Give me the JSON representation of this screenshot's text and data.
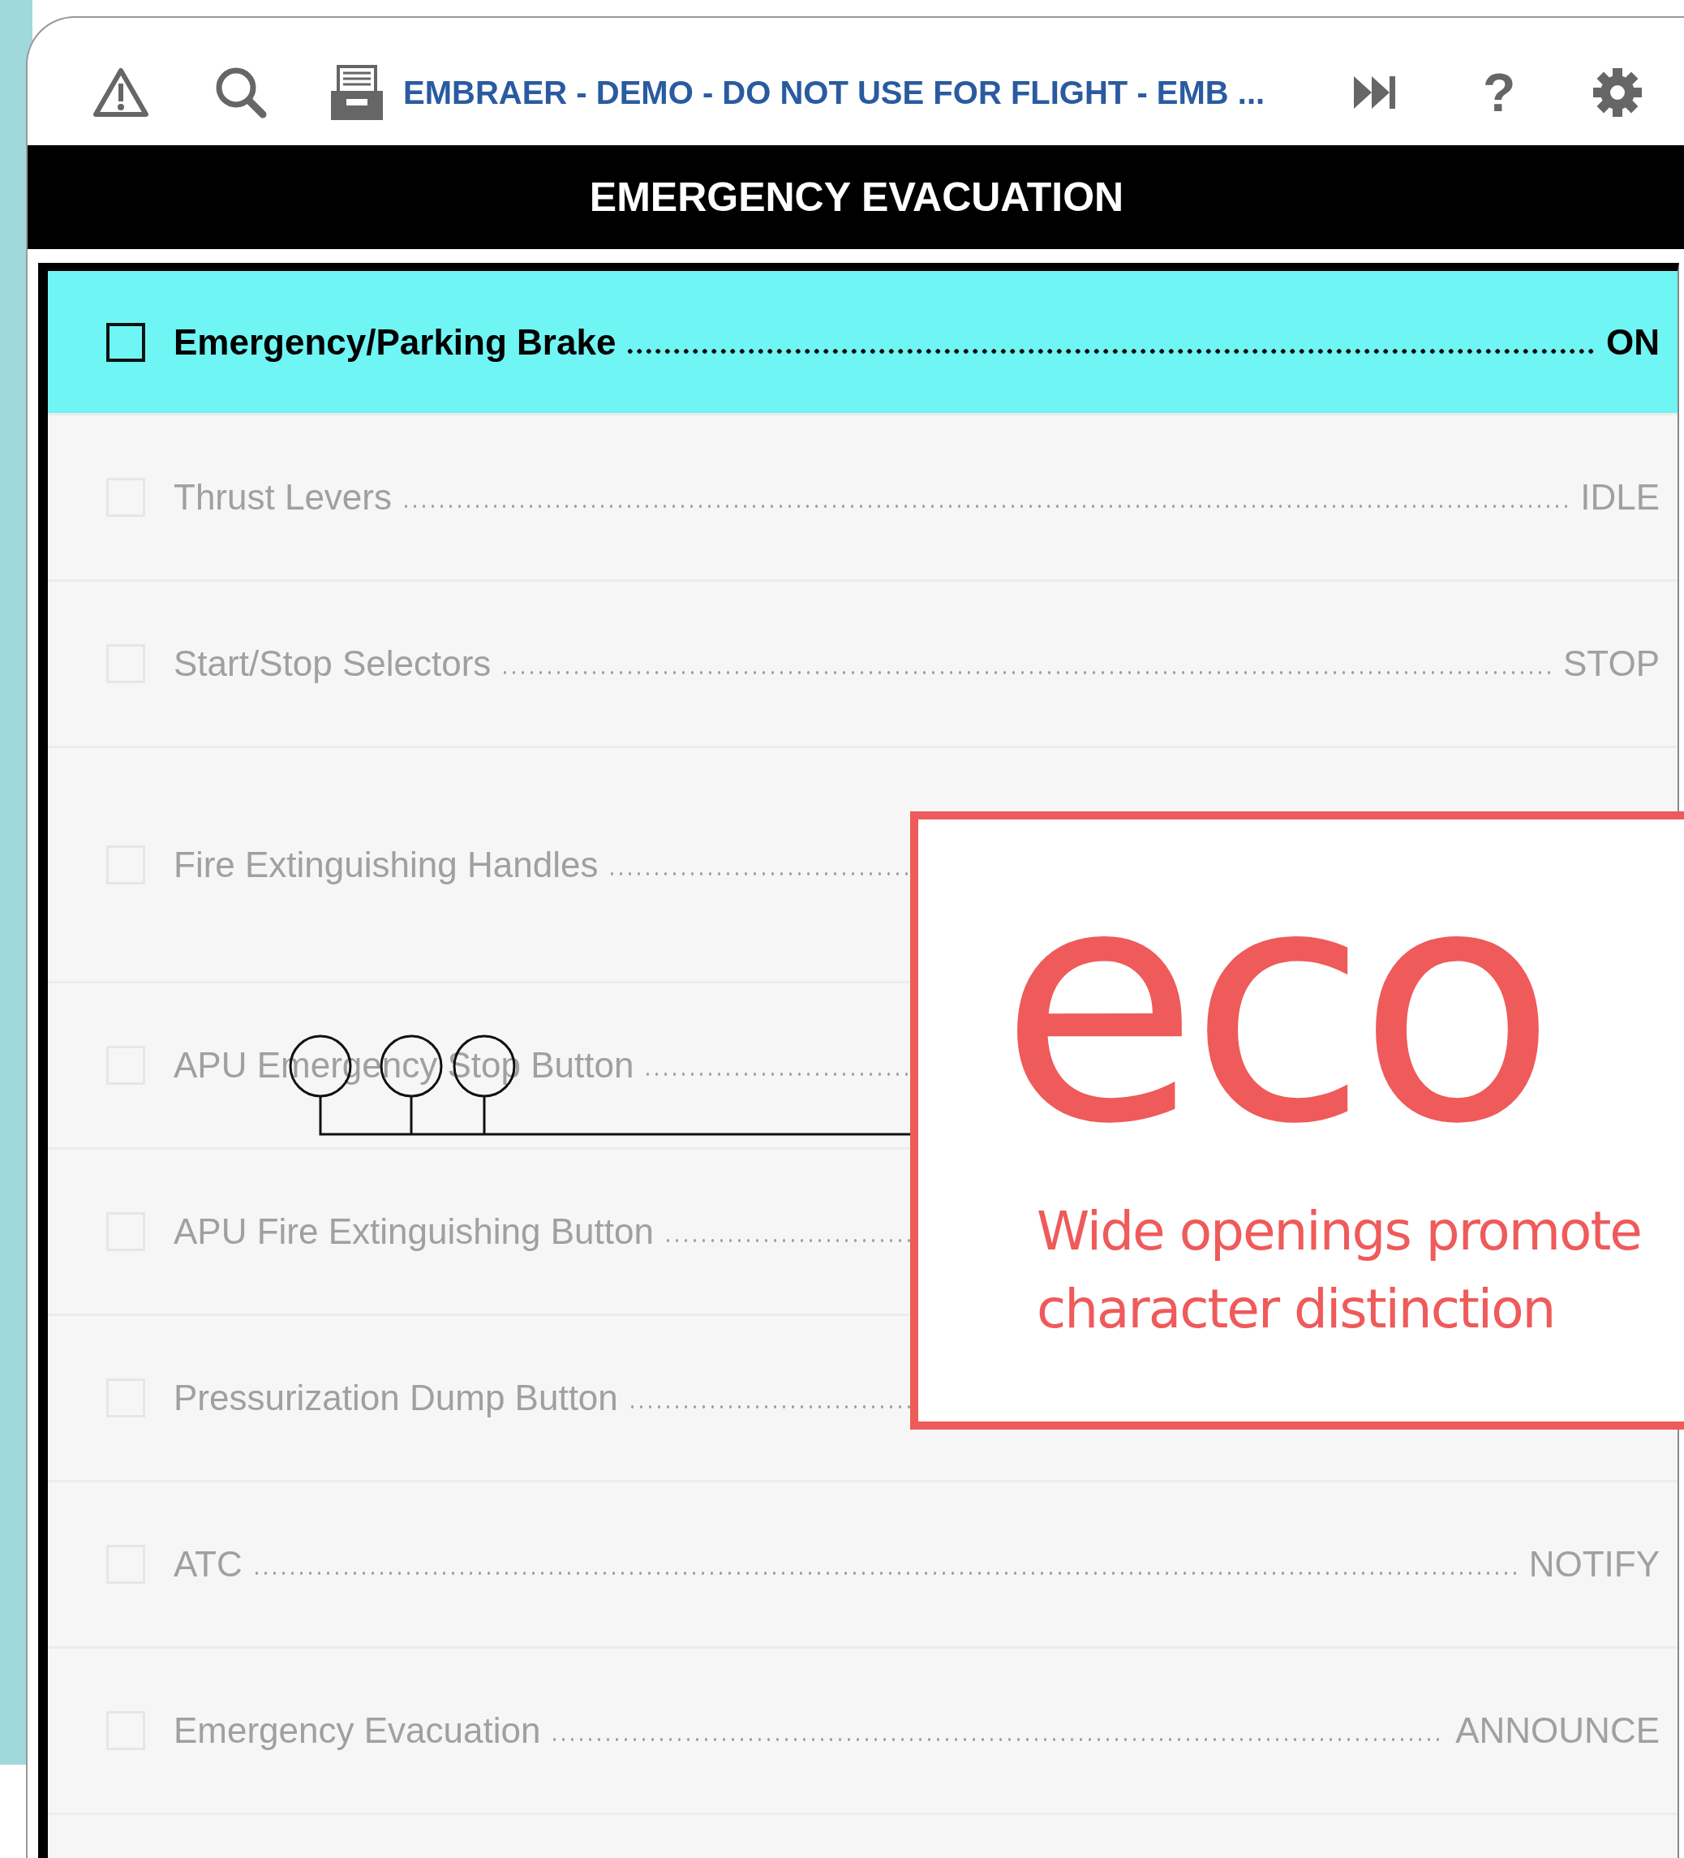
{
  "toolbar": {
    "title": "EMBRAER - DEMO - DO NOT USE FOR FLIGHT - EMB ...",
    "help": "?"
  },
  "header": {
    "title": "EMERGENCY EVACUATION"
  },
  "checklist": [
    {
      "label": "Emergency/Parking Brake",
      "value": "ON",
      "selected": true,
      "checked": false
    },
    {
      "label": "Thrust Levers",
      "value": "IDLE",
      "selected": false,
      "checked": false
    },
    {
      "label": "Start/Stop Selectors",
      "value": "STOP",
      "selected": false,
      "checked": false
    },
    {
      "label": "Fire Extinguishing Handles",
      "selected": false,
      "checked": false
    },
    {
      "label": "APU Emergency Stop Button",
      "selected": false,
      "checked": false
    },
    {
      "label": "APU Fire Extinguishing Button",
      "selected": false,
      "checked": false
    },
    {
      "label": "Pressurization Dump Button",
      "selected": false,
      "checked": false
    },
    {
      "label": "ATC",
      "value": "NOTIFY",
      "selected": false,
      "checked": false
    },
    {
      "label": "Emergency Evacuation",
      "value": "ANNOUNCE",
      "selected": false,
      "checked": false
    }
  ],
  "callout": {
    "sample": "eco",
    "caption_lines": [
      "Wide openings promote",
      "character distinction"
    ]
  }
}
